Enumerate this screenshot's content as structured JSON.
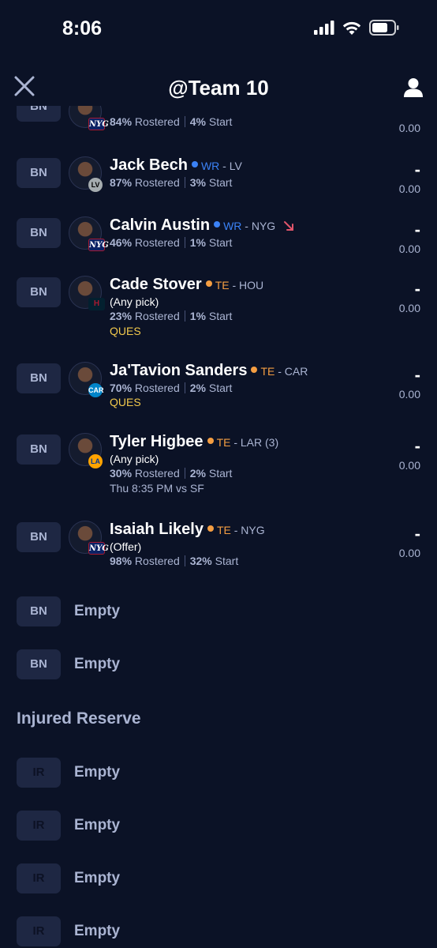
{
  "status_bar": {
    "time": "8:06"
  },
  "header": {
    "title": "@Team 10"
  },
  "colors": {
    "wr": "#3b82f6",
    "te": "#f59e42",
    "ques": "#f2c94c",
    "trend_down": "#e0556b"
  },
  "players": [
    {
      "slot": "BN",
      "name": "",
      "pos": "",
      "team": "",
      "rostered": "84%",
      "rostered_label": "Rostered",
      "start": "4%",
      "start_label": "Start",
      "proj": "",
      "score": "0.00",
      "logo": "NYG"
    },
    {
      "slot": "BN",
      "name": "Jack Bech",
      "pos": "WR",
      "team": " - LV",
      "rostered": "87%",
      "rostered_label": "Rostered",
      "start": "3%",
      "start_label": "Start",
      "proj": "-",
      "score": "0.00",
      "logo": "LV"
    },
    {
      "slot": "BN",
      "name": "Calvin Austin",
      "pos": "WR",
      "team": " - NYG",
      "rostered": "46%",
      "rostered_label": "Rostered",
      "start": "1%",
      "start_label": "Start",
      "proj": "-",
      "score": "0.00",
      "logo": "NYG"
    },
    {
      "slot": "BN",
      "name": "Cade Stover",
      "pos": "TE",
      "team": " - HOU",
      "note": "(Any pick)",
      "rostered": "23%",
      "rostered_label": "Rostered",
      "start": "1%",
      "start_label": "Start",
      "status": "QUES",
      "proj": "-",
      "score": "0.00",
      "logo": "H"
    },
    {
      "slot": "BN",
      "name": "Ja'Tavion Sanders",
      "pos": "TE",
      "team": " - CAR",
      "rostered": "70%",
      "rostered_label": "Rostered",
      "start": "2%",
      "start_label": "Start",
      "status": "QUES",
      "proj": "-",
      "score": "0.00",
      "logo": "CAR"
    },
    {
      "slot": "BN",
      "name": "Tyler Higbee",
      "pos": "TE",
      "team": " - LAR (3)",
      "note": "(Any pick)",
      "rostered": "30%",
      "rostered_label": "Rostered",
      "start": "2%",
      "start_label": "Start",
      "game": "Thu 8:35 PM vs SF",
      "proj": "-",
      "score": "0.00",
      "logo": "LA"
    },
    {
      "slot": "BN",
      "name": "Isaiah Likely",
      "pos": "TE",
      "team": " - NYG",
      "note": "(Offer)",
      "rostered": "98%",
      "rostered_label": "Rostered",
      "start": "32%",
      "start_label": "Start",
      "proj": "-",
      "score": "0.00",
      "logo": "NYG"
    }
  ],
  "bench_empty": [
    {
      "slot": "BN",
      "label": "Empty"
    },
    {
      "slot": "BN",
      "label": "Empty"
    }
  ],
  "injured_reserve": {
    "title": "Injured Reserve",
    "slots": [
      {
        "slot": "IR",
        "label": "Empty"
      },
      {
        "slot": "IR",
        "label": "Empty"
      },
      {
        "slot": "IR",
        "label": "Empty"
      },
      {
        "slot": "IR",
        "label": "Empty"
      }
    ]
  }
}
